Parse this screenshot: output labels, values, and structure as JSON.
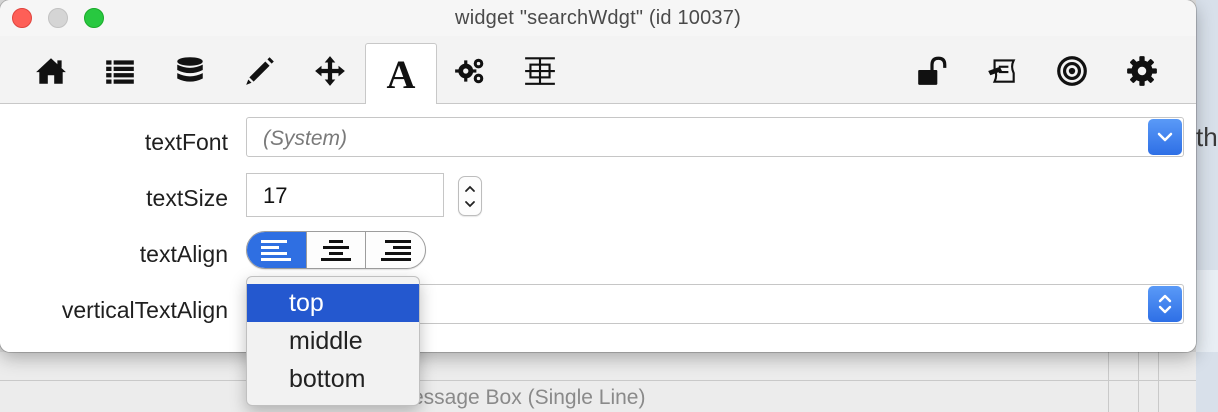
{
  "window": {
    "title": "widget \"searchWdgt\" (id 10037)"
  },
  "toolbar": {
    "items": [
      {
        "icon": "home-icon"
      },
      {
        "icon": "list-icon"
      },
      {
        "icon": "database-icon"
      },
      {
        "icon": "pencil-icon"
      },
      {
        "icon": "move-icon"
      },
      {
        "icon": "text-icon",
        "label": "A",
        "active": true
      },
      {
        "icon": "gears-icon"
      },
      {
        "icon": "geometry-icon"
      }
    ],
    "right_items": [
      {
        "icon": "unlock-icon"
      },
      {
        "icon": "script-icon"
      },
      {
        "icon": "target-icon"
      },
      {
        "icon": "settings-icon"
      }
    ]
  },
  "form": {
    "textFont_label": "textFont",
    "textFont_value": "(System)",
    "textSize_label": "textSize",
    "textSize_value": "17",
    "textAlign_label": "textAlign",
    "textAlign_options": [
      "left",
      "center",
      "right"
    ],
    "textAlign_selected": "left",
    "verticalTextAlign_label": "verticalTextAlign"
  },
  "dropdown": {
    "options": [
      "top",
      "middle",
      "bottom"
    ],
    "highlighted": "top"
  },
  "background": {
    "bottom_label": "essage Box (Single Line)",
    "right_text": "th"
  },
  "colors": {
    "accent": "#2f6fe2",
    "menu_highlight": "#2458cf",
    "close": "#fe5f57",
    "zoom": "#28c840"
  }
}
